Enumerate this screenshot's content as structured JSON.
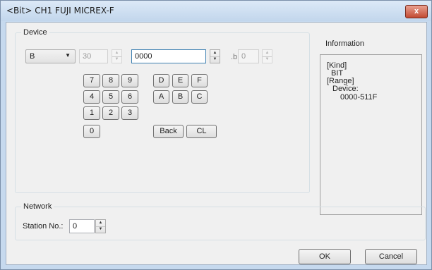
{
  "window": {
    "title": "<Bit> CH1 FUJI MICREX-F",
    "close_glyph": "x"
  },
  "device": {
    "legend": "Device",
    "device_type": "B",
    "channel_value": "30",
    "address_value": "0000",
    "bit_separator": ".b",
    "bit_value": "0"
  },
  "keypad": {
    "keys": [
      "7",
      "8",
      "9",
      "4",
      "5",
      "6",
      "1",
      "2",
      "3",
      "0"
    ],
    "hex_keys": [
      "D",
      "E",
      "F",
      "A",
      "B",
      "C"
    ],
    "back_label": "Back",
    "clear_label": "CL"
  },
  "information": {
    "title": "Information",
    "lines": [
      "[Kind]",
      "BIT",
      "[Range]",
      "Device:",
      "0000-511F"
    ]
  },
  "network": {
    "legend": "Network",
    "station_label": "Station No.:",
    "station_value": "0"
  },
  "buttons": {
    "ok": "OK",
    "cancel": "Cancel"
  }
}
